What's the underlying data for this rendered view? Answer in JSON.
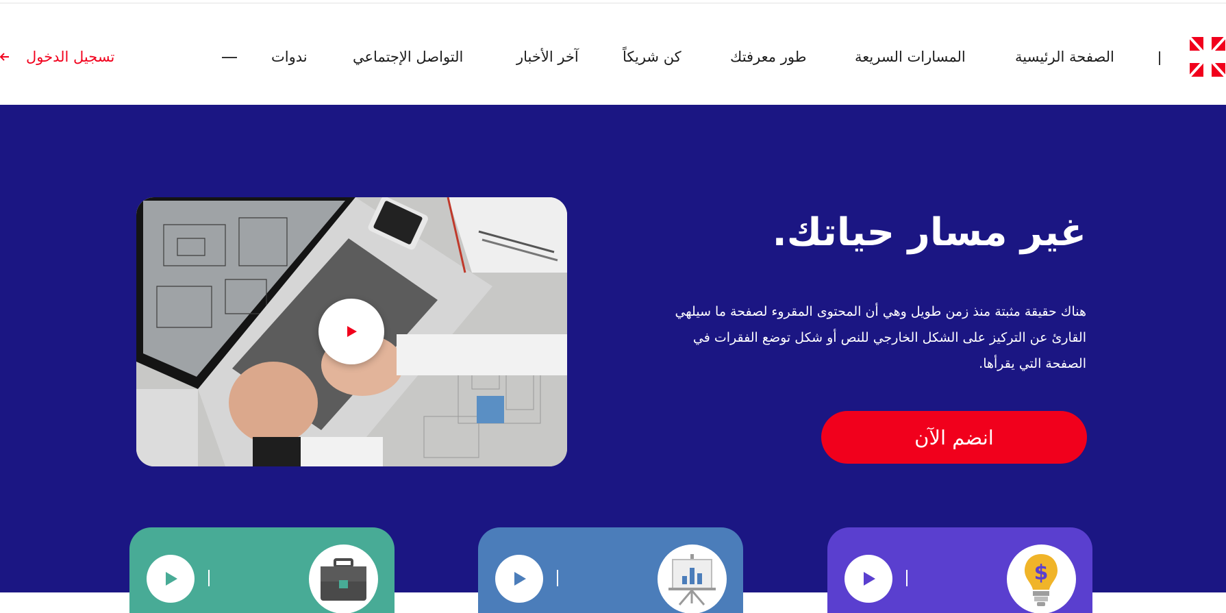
{
  "header": {
    "nav_items": [
      {
        "label": "الصفحة الرئيسية"
      },
      {
        "label": "المسارات السريعة"
      },
      {
        "label": "طور معرفتك"
      },
      {
        "label": "كن شريكاً"
      },
      {
        "label": "آخر الأخبار"
      },
      {
        "label": "التواصل الإجتماعي"
      },
      {
        "label": "ندوات"
      }
    ],
    "login_label": "تسجيل الدخول",
    "logo_icon": "asterisk-logo-icon",
    "login_icon": "arrow-left-icon"
  },
  "hero": {
    "title": "غير مسار حياتك.",
    "description": "هناك حقيقة مثبتة منذ زمن طويل وهي أن المحتوى المقروء لصفحة ما سيلهي القارئ عن التركيز على الشكل الخارجي للنص أو شكل توضع الفقرات في الصفحة التي يقرأها.",
    "cta_label": "انضم الآن",
    "video_icon": "play-icon"
  },
  "cards": [
    {
      "icon": "lightbulb-dollar-icon",
      "play_icon": "play-icon"
    },
    {
      "icon": "presentation-chart-icon",
      "play_icon": "play-icon"
    },
    {
      "icon": "briefcase-icon",
      "play_icon": "play-icon"
    }
  ],
  "colors": {
    "brand_red": "#f1001c",
    "hero_bg": "#1b1683",
    "card_purple": "#5a3fcf",
    "card_blue": "#4b7dba",
    "card_green": "#48ab96"
  }
}
